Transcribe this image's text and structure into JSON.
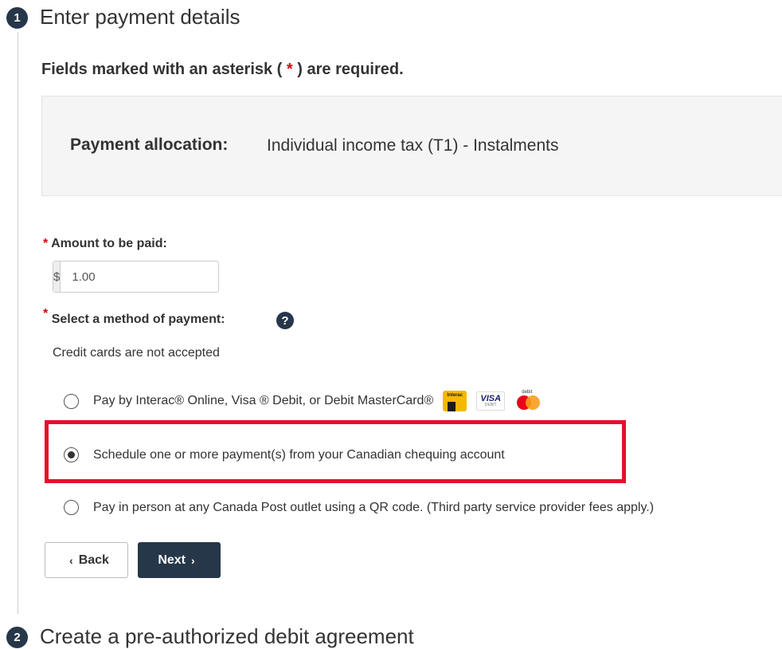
{
  "step1": {
    "number": "1",
    "title": "Enter payment details"
  },
  "required_note": {
    "prefix": "Fields marked with an asterisk (",
    "star": "*",
    "suffix": ") are required."
  },
  "allocation": {
    "label": "Payment allocation:",
    "value": "Individual income tax (T1) - Instalments"
  },
  "amount": {
    "required_star": "*",
    "label": "Amount to be paid:",
    "currency_symbol": "$",
    "value": "1.00"
  },
  "method": {
    "required_star": "*",
    "label": "Select a method of payment:",
    "help_icon": "?",
    "hint": "Credit cards are not accepted",
    "options": [
      {
        "label": "Pay by Interac® Online, Visa ® Debit, or Debit MasterCard®",
        "checked": false,
        "logos": [
          "interac-logo",
          "visa-debit-logo",
          "debit-mastercard-logo"
        ]
      },
      {
        "label": "Schedule one or more payment(s) from your Canadian chequing account",
        "checked": true
      },
      {
        "label": "Pay in person at any Canada Post outlet using a QR code. (Third party service provider fees apply.)",
        "checked": false
      }
    ]
  },
  "buttons": {
    "back": "Back",
    "next": "Next",
    "back_icon": "‹",
    "next_icon": "›"
  },
  "step2": {
    "number": "2",
    "title": "Create a pre-authorized debit agreement"
  },
  "colors": {
    "primary": "#26374a",
    "required": "#d3080c",
    "highlight": "#e4112a",
    "panel_bg": "#f5f5f5"
  }
}
